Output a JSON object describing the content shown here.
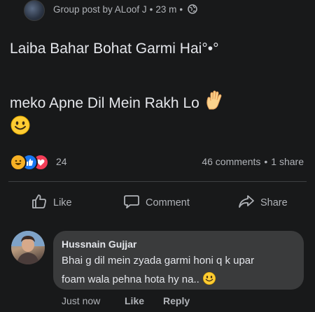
{
  "header": {
    "meta_text": "Group post by ALoof J",
    "dot": "•",
    "time": "23 m",
    "privacy_icon": "globe-icon"
  },
  "post": {
    "line1": "Laiba Bahar Bohat Garmi Hai°•°",
    "line2": "meko Apne Dil Mein Rakh Lo",
    "line2_emoji": "raised-hand-icon",
    "line3_emoji": "smiley-icon"
  },
  "reactions": {
    "icons": [
      "haha-reaction-icon",
      "like-reaction-icon",
      "love-reaction-icon"
    ],
    "count": "24"
  },
  "stats": {
    "comments": "46 comments",
    "dot": "•",
    "shares": "1 share"
  },
  "actions": {
    "like_label": "Like",
    "comment_label": "Comment",
    "share_label": "Share"
  },
  "comment": {
    "author": "Hussnain Gujjar",
    "text_line1": "Bhai g dil mein zyada garmi honi q k upar",
    "text_line2": "foam wala pehna hota hy na..",
    "emoji": "smiley-icon",
    "time": "Just now",
    "like_label": "Like",
    "reply_label": "Reply"
  },
  "colors": {
    "background": "#18191a",
    "bubble": "#3a3b3c",
    "text_primary": "#e4e6eb",
    "text_secondary": "#b0b3b8",
    "like_blue": "#1877f2",
    "love_red": "#f33e58",
    "haha_yellow": "#f7b125"
  }
}
